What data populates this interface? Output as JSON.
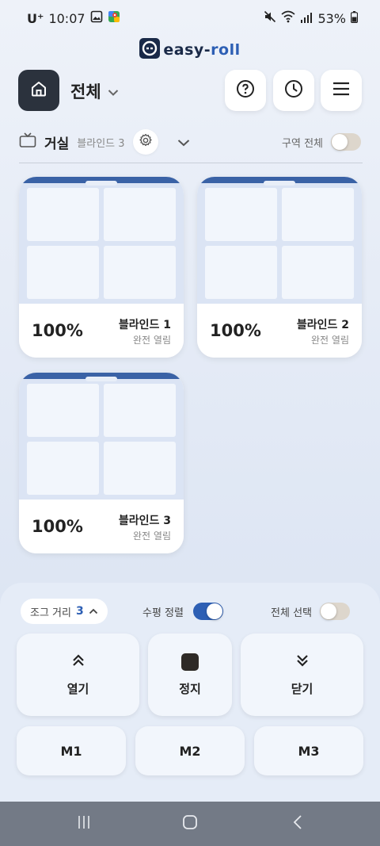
{
  "status_bar": {
    "carrier": "U⁺",
    "time": "10:07",
    "battery": "53%"
  },
  "app": {
    "logo_main": "easy-",
    "logo_accent": "roll"
  },
  "header": {
    "title": "전체"
  },
  "zone": {
    "name": "거실",
    "count_label": "블라인드 3",
    "all_zone_label": "구역 전체",
    "all_zone_on": false
  },
  "blinds": [
    {
      "percent": "100%",
      "name": "블라인드 1",
      "state": "완전 열림",
      "open_fraction": 1.0
    },
    {
      "percent": "100%",
      "name": "블라인드 2",
      "state": "완전 열림",
      "open_fraction": 1.0
    },
    {
      "percent": "100%",
      "name": "블라인드 3",
      "state": "완전 열림",
      "open_fraction": 1.0
    }
  ],
  "controls": {
    "jog_label": "조그 거리",
    "jog_value": "3",
    "align_label": "수평 정렬",
    "align_on": true,
    "select_all_label": "전체 선택",
    "select_all_on": false,
    "open_label": "열기",
    "stop_label": "정지",
    "close_label": "닫기",
    "m1": "M1",
    "m2": "M2",
    "m3": "M3"
  },
  "colors": {
    "accent": "#2d5fb4",
    "dark": "#2b323d"
  }
}
